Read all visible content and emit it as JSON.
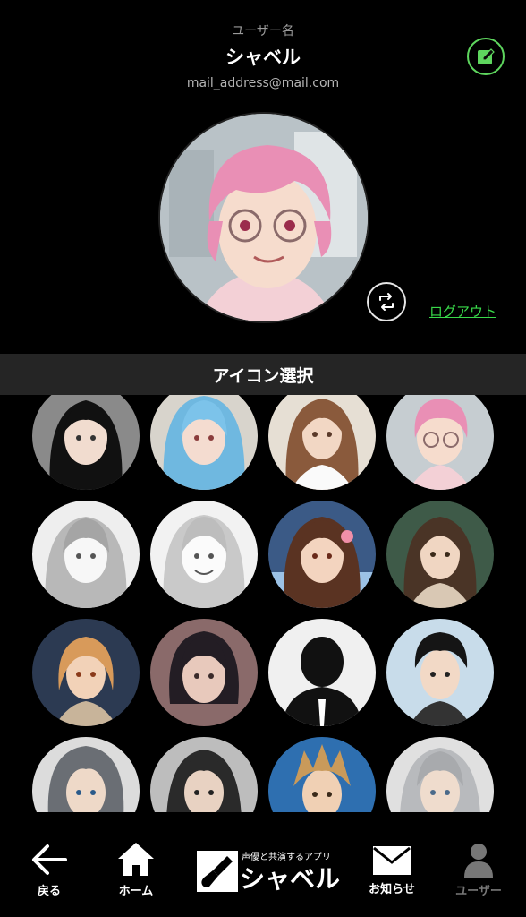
{
  "profile": {
    "username_label": "ユーザー名",
    "username": "シャベル",
    "email": "mail_address@mail.com",
    "logout_label": "ログアウト"
  },
  "icon_section": {
    "title": "アイコン選択"
  },
  "icons": [
    {
      "name": "long-black-hair-girl"
    },
    {
      "name": "blue-hair-girl"
    },
    {
      "name": "brown-hair-nurse"
    },
    {
      "name": "pink-hair-glasses"
    },
    {
      "name": "sketch-wavy-hair-girl"
    },
    {
      "name": "sketch-smiling-girl"
    },
    {
      "name": "flower-hair-girl"
    },
    {
      "name": "brown-hair-girl-forest"
    },
    {
      "name": "short-blonde-girl"
    },
    {
      "name": "black-bob-girl"
    },
    {
      "name": "silhouette-default"
    },
    {
      "name": "black-hair-boy"
    },
    {
      "name": "gray-hair-boy"
    },
    {
      "name": "long-dark-hair-man"
    },
    {
      "name": "spiky-blonde-boy"
    },
    {
      "name": "silver-hair-man"
    }
  ],
  "nav": {
    "back_label": "戻る",
    "home_label": "ホーム",
    "brand_tagline": "声優と共演するアプリ",
    "brand_name": "シャベル",
    "news_label": "お知らせ",
    "user_label": "ユーザー"
  },
  "colors": {
    "accent_green": "#39d94a",
    "background": "#000000",
    "section_bar": "#252525",
    "inactive_nav": "#777777"
  }
}
